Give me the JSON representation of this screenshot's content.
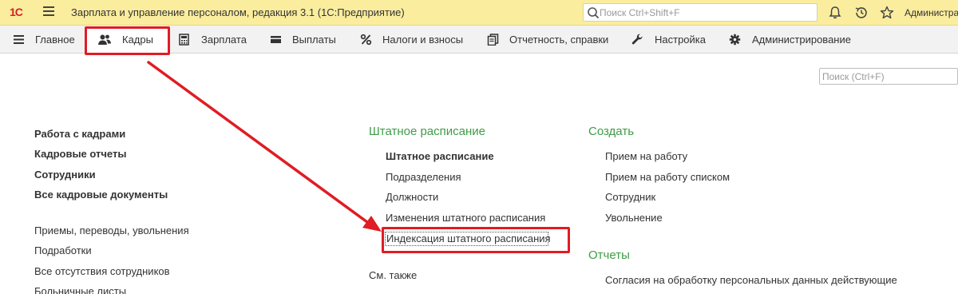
{
  "titlebar": {
    "logo": "1С",
    "app_title": "Зарплата и управление персоналом, редакция 3.1  (1С:Предприятие)",
    "search_placeholder": "Поиск Ctrl+Shift+F",
    "user_name": "Администрат",
    "icons": [
      "menu-icon",
      "search-icon",
      "bell-icon",
      "history-icon",
      "star-icon"
    ]
  },
  "sections": [
    {
      "label": "Главное",
      "icon": "menu-lines-icon"
    },
    {
      "label": "Кадры",
      "icon": "people-icon",
      "active": true
    },
    {
      "label": "Зарплата",
      "icon": "calculator-icon"
    },
    {
      "label": "Выплаты",
      "icon": "wallet-icon"
    },
    {
      "label": "Налоги и взносы",
      "icon": "percent-icon"
    },
    {
      "label": "Отчетность, справки",
      "icon": "documents-icon"
    },
    {
      "label": "Настройка",
      "icon": "wrench-icon"
    },
    {
      "label": "Администрирование",
      "icon": "gear-icon"
    }
  ],
  "content": {
    "search_placeholder": "Поиск (Ctrl+F)",
    "left_col_bold": [
      "Работа с кадрами",
      "Кадровые отчеты",
      "Сотрудники",
      "Все кадровые документы"
    ],
    "left_col": [
      "Приемы, переводы, увольнения",
      "Подработки",
      "Все отсутствия сотрудников",
      "Больничные листы"
    ],
    "staff_group": {
      "title": "Штатное расписание",
      "items": [
        "Штатное расписание",
        "Подразделения",
        "Должности",
        "Изменения штатного расписания",
        "Индексация штатного расписания"
      ]
    },
    "see_also": "См. также",
    "create_group": {
      "title": "Создать",
      "items": [
        "Прием на работу",
        "Прием на работу списком",
        "Сотрудник",
        "Увольнение"
      ]
    },
    "reports_group": {
      "title": "Отчеты",
      "items": [
        "Согласия на обработку персональных данных действующие"
      ]
    }
  },
  "colors": {
    "titlebar_bg": "#fbed9e",
    "section_bg": "#f2f2f2",
    "group_title": "#3f9c47",
    "highlight": "#e01c24",
    "logo": "#d71f26"
  }
}
